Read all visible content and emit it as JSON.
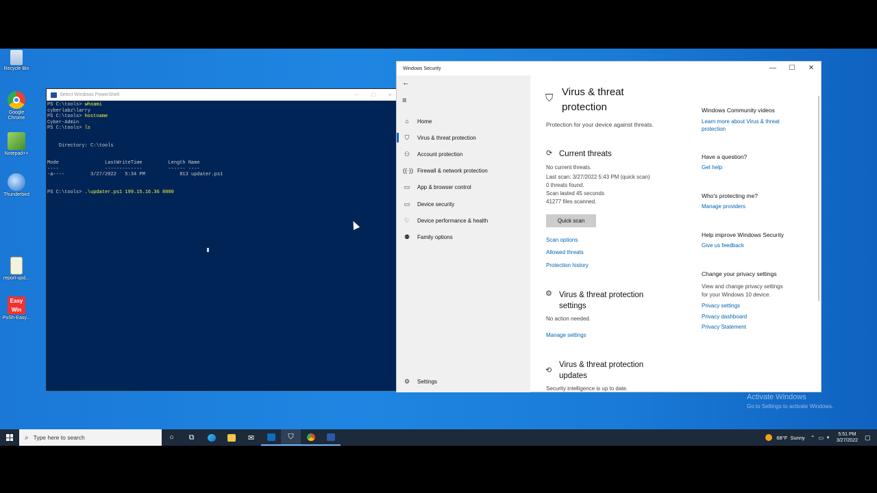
{
  "desktop_icons": [
    {
      "label": "Recycle Bin",
      "icon": "recycle-bin-icon"
    },
    {
      "label": "Google Chrome",
      "icon": "chrome-icon"
    },
    {
      "label": "Notepad++",
      "icon": "notepadpp-icon"
    },
    {
      "label": "Thunderbird",
      "icon": "thunderbird-icon"
    },
    {
      "label": "report-upd...",
      "icon": "file-icon"
    },
    {
      "label": "PoSh-Easy...",
      "icon": "easy-win-icon"
    }
  ],
  "powershell": {
    "title": "Select Windows PowerShell",
    "lines": [
      {
        "prompt": "PS C:\\tools> ",
        "cmd": "whoami"
      },
      {
        "out": "cyberlabz\\larry"
      },
      {
        "prompt": "PS C:\\tools> ",
        "cmd": "hostname"
      },
      {
        "out": "Cyber-Admin"
      },
      {
        "prompt": "PS C:\\tools> ",
        "cmd": "ls"
      },
      {
        "out": ""
      },
      {
        "out": ""
      },
      {
        "out": "    Directory: C:\\tools"
      },
      {
        "out": ""
      },
      {
        "out": ""
      },
      {
        "out": "Mode                LastWriteTime         Length Name"
      },
      {
        "out": "----                -------------         ------ ----"
      },
      {
        "out": "-a----         3/27/2022   5:34 PM            813 updater.ps1"
      },
      {
        "out": ""
      },
      {
        "out": ""
      },
      {
        "prompt": "PS C:\\tools> ",
        "cmd": ".\\updater.ps1 199.15.16.36 8080"
      }
    ]
  },
  "security": {
    "window_title": "Windows Security",
    "nav": {
      "items": [
        {
          "label": "Home",
          "icon": "home-icon"
        },
        {
          "label": "Virus & threat protection",
          "icon": "shield-icon",
          "active": true
        },
        {
          "label": "Account protection",
          "icon": "person-icon"
        },
        {
          "label": "Firewall & network protection",
          "icon": "wifi-icon"
        },
        {
          "label": "App & browser control",
          "icon": "app-browser-icon"
        },
        {
          "label": "Device security",
          "icon": "laptop-icon"
        },
        {
          "label": "Device performance & health",
          "icon": "heart-icon"
        },
        {
          "label": "Family options",
          "icon": "family-icon"
        }
      ],
      "settings_label": "Settings"
    },
    "main": {
      "title_line1": "Virus & threat",
      "title_line2": "protection",
      "subtitle": "Protection for your device against threats.",
      "current_threats": {
        "heading": "Current threats",
        "lines": [
          "No current threats.",
          "Last scan: 3/27/2022 5:43 PM (quick scan)",
          "0 threats found.",
          "Scan lasted 45 seconds",
          "41277 files scanned."
        ],
        "quick_scan_label": "Quick scan",
        "links": [
          "Scan options",
          "Allowed threats",
          "Protection history"
        ]
      },
      "settings_section": {
        "heading_line1": "Virus & threat protection",
        "heading_line2": "settings",
        "status": "No action needed.",
        "link": "Manage settings"
      },
      "updates_section": {
        "heading_line1": "Virus & threat protection",
        "heading_line2": "updates",
        "status": "Security intelligence is up to date."
      }
    },
    "side": {
      "community": {
        "heading": "Windows Community videos",
        "link_line1": "Learn more about Virus & threat",
        "link_line2": "protection"
      },
      "question": {
        "heading": "Have a question?",
        "link": "Get help"
      },
      "protecting": {
        "heading": "Who's protecting me?",
        "link": "Manage providers"
      },
      "improve": {
        "heading": "Help improve Windows Security",
        "link": "Give us feedback"
      },
      "privacy": {
        "heading": "Change your privacy settings",
        "text_line1": "View and change privacy settings",
        "text_line2": "for your Windows 10 device.",
        "links": [
          "Privacy settings",
          "Privacy dashboard",
          "Privacy Statement"
        ]
      }
    }
  },
  "activate": {
    "line1": "Activate Windows",
    "line2": "Go to Settings to activate Windows."
  },
  "taskbar": {
    "search_placeholder": "Type here to search",
    "apps": [
      "cortana-icon",
      "task-view-icon",
      "edge-icon",
      "file-explorer-icon",
      "mail-icon",
      "outlook-icon",
      "windows-security-icon",
      "chrome-icon",
      "powershell-icon"
    ],
    "weather": {
      "temp": "68°F",
      "condition": "Sunny"
    },
    "time": "5:51 PM",
    "date": "3/27/2022"
  }
}
